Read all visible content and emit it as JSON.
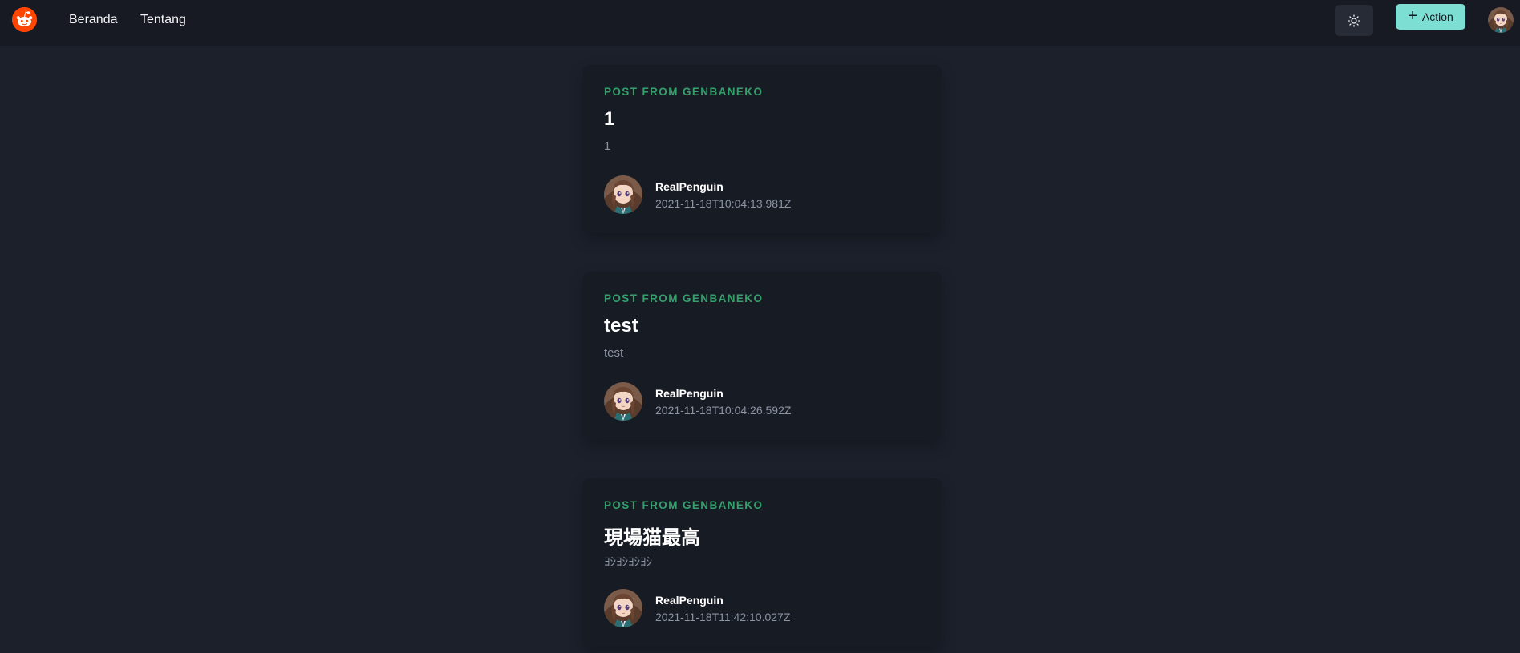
{
  "nav": {
    "links": [
      {
        "label": "Beranda"
      },
      {
        "label": "Tentang"
      }
    ],
    "theme_icon": "sun-icon",
    "action": {
      "icon": "plus-icon",
      "label": "Action"
    },
    "brand_icon": "reddit-logo-icon"
  },
  "posts": [
    {
      "kicker": "Post from genbaneko",
      "title": "1",
      "body": "1",
      "author": "RealPenguin",
      "date": "2021-11-18T10:04:13.981Z"
    },
    {
      "kicker": "Post from genbaneko",
      "title": "test",
      "body": "test",
      "author": "RealPenguin",
      "date": "2021-11-18T10:04:26.592Z"
    },
    {
      "kicker": "Post from genbaneko",
      "title": "現場猫最高",
      "body": "ﾖｼﾖｼﾖｼﾖｼ",
      "author": "RealPenguin",
      "date": "2021-11-18T11:42:10.027Z"
    }
  ],
  "colors": {
    "page_bg": "#1b202b",
    "nav_bg": "#171a23",
    "card_bg": "#171b24",
    "kicker": "#35a06b",
    "action_bg": "#7ddfd3",
    "muted_text": "#8c93a2",
    "brand": "#ff4500"
  }
}
